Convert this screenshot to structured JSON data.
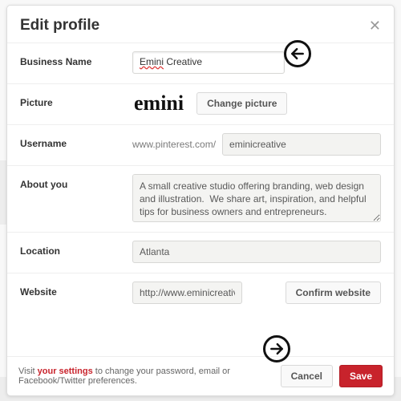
{
  "backdrop": {
    "ghost_title": "Emini Creative"
  },
  "modal": {
    "title": "Edit profile",
    "close_glyph": "✕"
  },
  "fields": {
    "business_name": {
      "label": "Business Name",
      "value_misspelled": "Emini",
      "value_rest": " Creative"
    },
    "picture": {
      "label": "Picture",
      "logo_text": "emini",
      "change_button": "Change picture"
    },
    "username": {
      "label": "Username",
      "prefix": "www.pinterest.com/",
      "value": "eminicreative"
    },
    "about": {
      "label": "About you",
      "value": "A small creative studio offering branding, web design and illustration.  We share art, inspiration, and helpful tips for business owners and entrepreneurs."
    },
    "location": {
      "label": "Location",
      "value": "Atlanta"
    },
    "website": {
      "label": "Website",
      "value": "http://www.eminicreative.com/",
      "confirm_button": "Confirm website"
    }
  },
  "footer": {
    "visit_pre": "Visit ",
    "link": "your settings",
    "visit_post": " to change your password, email or Facebook/Twitter preferences.",
    "cancel": "Cancel",
    "save": "Save"
  }
}
